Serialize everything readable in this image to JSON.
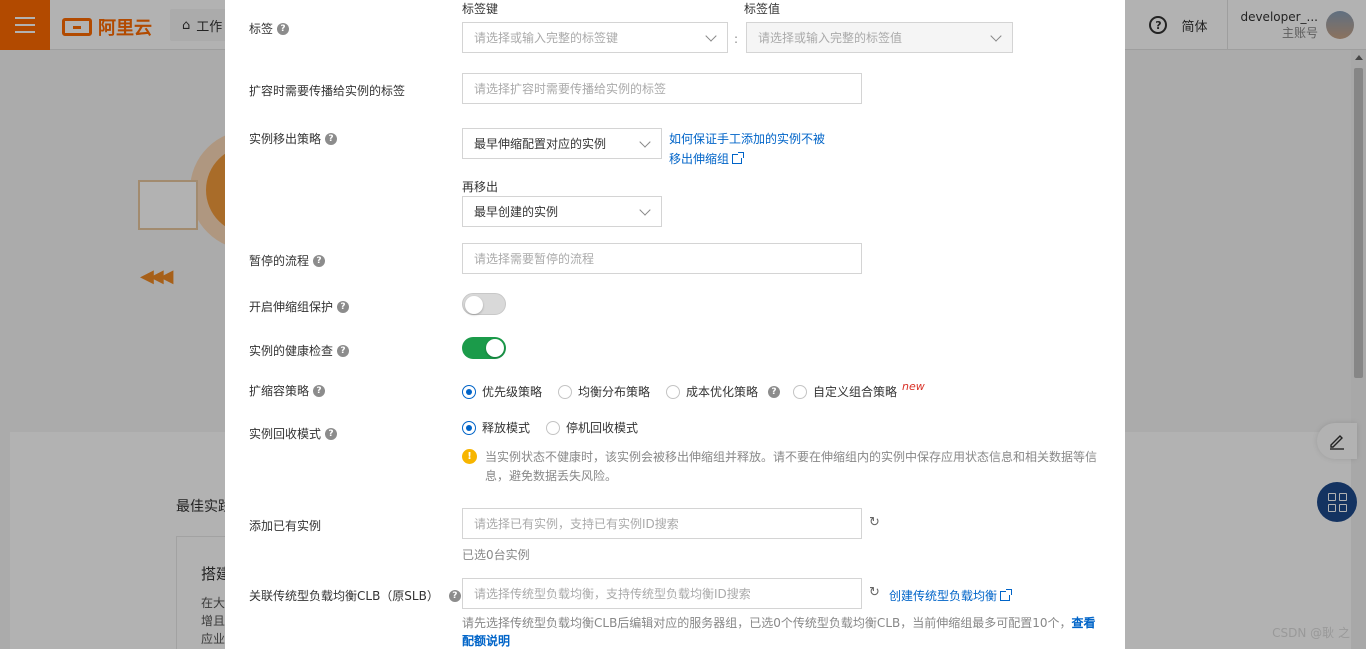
{
  "topbar": {
    "logo": "阿里云",
    "workbench": "工作",
    "lang": "简体",
    "account_name": "developer_...",
    "account_role": "主账号"
  },
  "background": {
    "best_practice": "最佳实践",
    "panel_title": "搭建",
    "panel_lines": [
      "在大",
      "增且",
      "应业"
    ]
  },
  "form": {
    "tags": {
      "label": "标签",
      "key_label": "标签键",
      "value_label": "标签值",
      "key_placeholder": "请选择或输入完整的标签键",
      "value_placeholder": "请选择或输入完整的标签值"
    },
    "propagate_tags": {
      "label": "扩容时需要传播给实例的标签",
      "placeholder": "请选择扩容时需要传播给实例的标签"
    },
    "removal_policy": {
      "label": "实例移出策略",
      "value": "最早伸缩配置对应的实例",
      "link_line1": "如何保证手工添加的实例不被",
      "link_line2": "移出伸缩组",
      "then_label": "再移出",
      "then_value": "最早创建的实例"
    },
    "suspended": {
      "label": "暂停的流程",
      "placeholder": "请选择需要暂停的流程"
    },
    "protection": {
      "label": "开启伸缩组保护",
      "enabled": false
    },
    "health_check": {
      "label": "实例的健康检查",
      "enabled": true
    },
    "scaling_policy": {
      "label": "扩缩容策略",
      "options": [
        "优先级策略",
        "均衡分布策略",
        "成本优化策略",
        "自定义组合策略"
      ],
      "selected": "优先级策略",
      "new_tag": "new"
    },
    "recycle_mode": {
      "label": "实例回收模式",
      "options": [
        "释放模式",
        "停机回收模式"
      ],
      "selected": "释放模式",
      "warning": "当实例状态不健康时，该实例会被移出伸缩组并释放。请不要在伸缩组内的实例中保存应用状态信息和相关数据等信息，避免数据丢失风险。"
    },
    "add_instances": {
      "label": "添加已有实例",
      "placeholder": "请选择已有实例，支持已有实例ID搜索",
      "selected_note": "已选0台实例"
    },
    "clb": {
      "label": "关联传统型负载均衡CLB（原SLB）",
      "placeholder": "请选择传统型负载均衡，支持传统型负载均衡ID搜索",
      "create_link": "创建传统型负载均衡",
      "note": "请先选择传统型负载均衡CLB后编辑对应的服务器组，已选0个传统型负载均衡CLB，当前伸缩组最多可配置10个，",
      "note_link": "查看配额说明"
    }
  },
  "watermark": "CSDN @耿 之",
  "colors": {
    "accent": "#0064c8",
    "brand": "#ff6a00",
    "switch_on": "#1b9b4a",
    "warning": "#f7b500",
    "new_tag": "#d93026"
  }
}
